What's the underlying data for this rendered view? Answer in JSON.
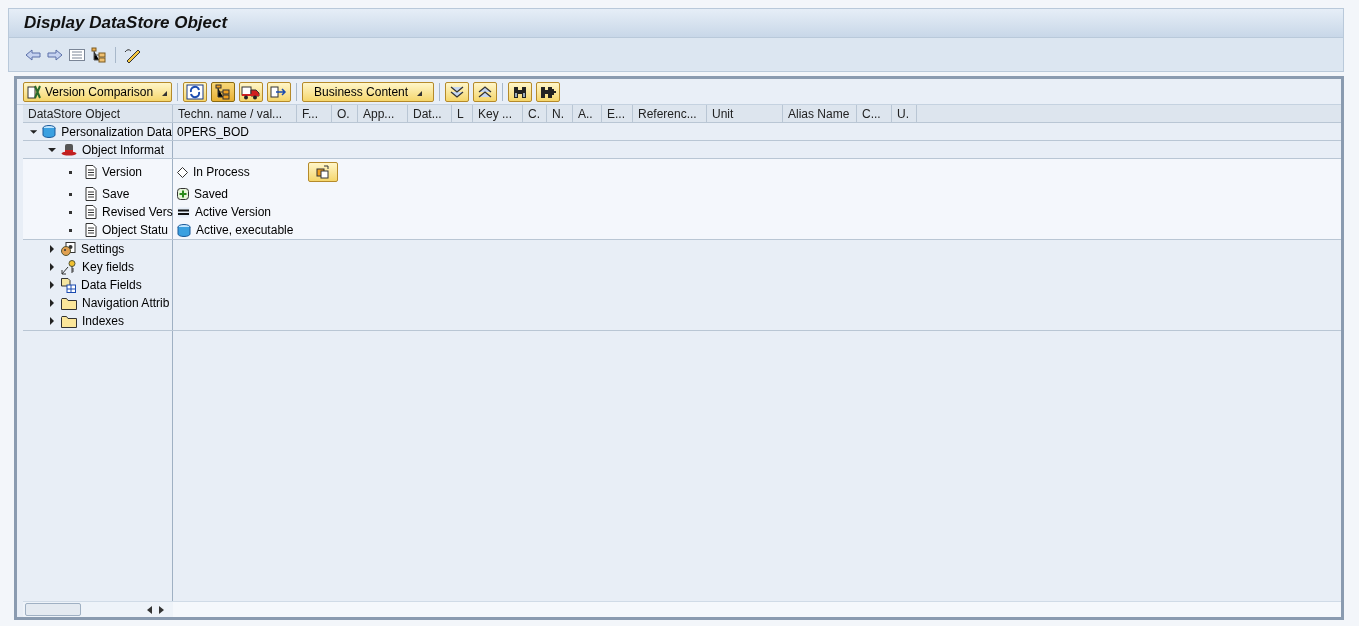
{
  "window": {
    "title": "Display DataStore Object"
  },
  "app_toolbar": [
    {
      "kind": "back"
    },
    {
      "kind": "forward"
    },
    {
      "kind": "list"
    },
    {
      "kind": "hierarchy"
    },
    {
      "kind": "separator"
    },
    {
      "kind": "edit"
    }
  ],
  "toolbar": [
    {
      "kind": "menu",
      "label": "Version Comparison"
    },
    {
      "kind": "separator"
    },
    {
      "kind": "icon",
      "selected": false
    },
    {
      "kind": "icon",
      "selected": true
    },
    {
      "kind": "icon",
      "selected": false
    },
    {
      "kind": "icon",
      "selected": false
    },
    {
      "kind": "separator"
    },
    {
      "kind": "menu",
      "label": "Business Content"
    },
    {
      "kind": "separator"
    },
    {
      "kind": "icon",
      "selected": false
    },
    {
      "kind": "icon",
      "selected": false
    },
    {
      "kind": "separator"
    },
    {
      "kind": "icon",
      "selected": false
    },
    {
      "kind": "icon",
      "selected": false
    }
  ],
  "table": {
    "columns": [
      "DataStore Object",
      "Techn. name / val...",
      "F...",
      "O.",
      "App...",
      "Dat...",
      "L",
      "Key ...",
      "C.",
      "N.",
      "A..",
      "E...",
      "Referenc...",
      "Unit",
      "Alias Name",
      "C...",
      "U."
    ],
    "tree": [
      {
        "label": "Personalization Data",
        "kind": "database",
        "value": "0PERS_BOD",
        "expanded": true,
        "children": [
          {
            "label": "Object Informat",
            "kind": "hat",
            "expanded": true,
            "children": [
              {
                "label": "Version",
                "kind": "document",
                "value": "In Process",
                "has_button": true
              },
              {
                "label": "Save",
                "kind": "document",
                "value": "Saved"
              },
              {
                "label": "Revised Vers",
                "kind": "document",
                "value": "Active Version"
              },
              {
                "label": "Object Statu",
                "kind": "document",
                "value": "Active, executable"
              }
            ]
          },
          {
            "label": "Settings",
            "kind": "settings",
            "expanded": false
          },
          {
            "label": "Key fields",
            "kind": "key",
            "expanded": false
          },
          {
            "label": "Data Fields",
            "kind": "datafields",
            "expanded": false
          },
          {
            "label": "Navigation Attrib",
            "kind": "folder",
            "expanded": false
          },
          {
            "label": "Indexes",
            "kind": "folder",
            "expanded": false
          }
        ]
      }
    ]
  }
}
